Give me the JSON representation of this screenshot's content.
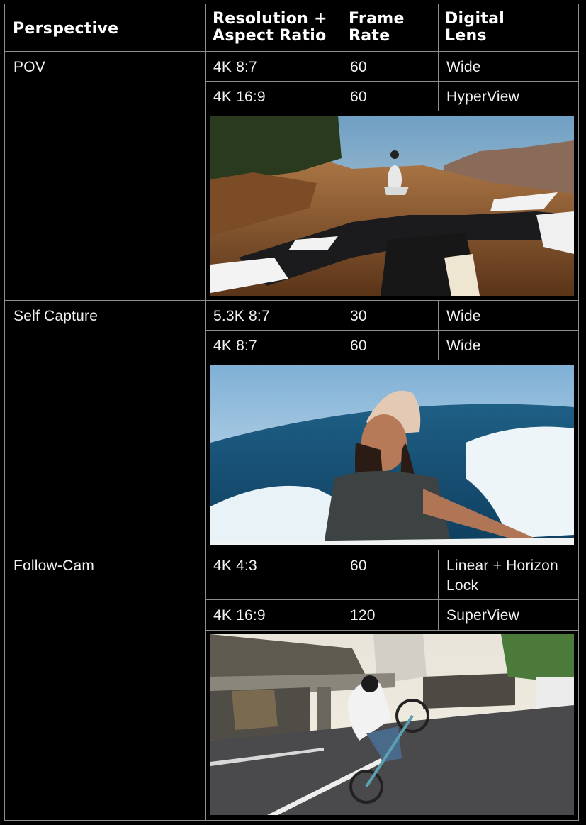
{
  "header": {
    "perspective": "Perspective",
    "resolution_line1": "Resolution +",
    "resolution_line2": "Aspect Ratio",
    "frame_rate_line1": "Frame",
    "frame_rate_line2": "Rate",
    "lens_line1": "Digital",
    "lens_line2": "Lens"
  },
  "groups": [
    {
      "perspective": "POV",
      "rows": [
        {
          "resolution": "4K 8:7",
          "frame_rate": "60",
          "lens": "Wide"
        },
        {
          "resolution": "4K 16:9",
          "frame_rate": "60",
          "lens": "HyperView"
        }
      ],
      "photo_icon": "motocross-pov-photo"
    },
    {
      "perspective": "Self Capture",
      "rows": [
        {
          "resolution": "5.3K 8:7",
          "frame_rate": "30",
          "lens": "Wide"
        },
        {
          "resolution": "4K 8:7",
          "frame_rate": "60",
          "lens": "Wide"
        }
      ],
      "photo_icon": "boat-selfie-photo"
    },
    {
      "perspective": "Follow-Cam",
      "rows": [
        {
          "resolution": "4K 4:3",
          "frame_rate": "60",
          "lens_line1": "Linear + Horizon",
          "lens_line2": "Lock"
        },
        {
          "resolution": "4K 16:9",
          "frame_rate": "120",
          "lens": "SuperView"
        }
      ],
      "photo_icon": "bike-wheelie-photo"
    }
  ],
  "colors": {
    "background": "#000000",
    "grid": "#8e8e8e",
    "text": "#f2f2f2"
  }
}
